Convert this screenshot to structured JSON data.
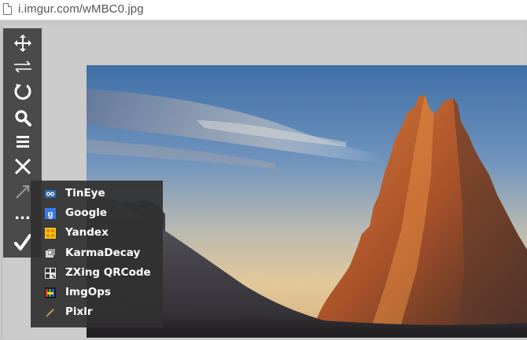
{
  "address_bar": {
    "url": "i.imgur.com/wMBC0.jpg",
    "page_icon": "document-icon"
  },
  "toolbar": {
    "tools": [
      {
        "name": "move-icon"
      },
      {
        "name": "flip-icon"
      },
      {
        "name": "rotate-icon"
      },
      {
        "name": "search-icon"
      },
      {
        "name": "menu-icon"
      },
      {
        "name": "close-icon"
      },
      {
        "name": "arrow-icon"
      },
      {
        "name": "more-icon",
        "label": "..."
      },
      {
        "name": "checkmark-icon"
      }
    ]
  },
  "search_menu": {
    "items": [
      {
        "label": "TinEye",
        "icon": "tineye-icon"
      },
      {
        "label": "Google",
        "icon": "google-icon"
      },
      {
        "label": "Yandex",
        "icon": "yandex-icon"
      },
      {
        "label": "KarmaDecay",
        "icon": "karmadecay-icon"
      },
      {
        "label": "ZXing QRCode",
        "icon": "qrcode-icon"
      },
      {
        "label": "ImgOps",
        "icon": "imgops-icon"
      },
      {
        "label": "Pixlr",
        "icon": "pixlr-icon"
      }
    ]
  },
  "colors": {
    "toolbar_bg": "#4a4a4a",
    "menu_bg": "#303030",
    "viewer_bg": "#c8c8c8"
  }
}
